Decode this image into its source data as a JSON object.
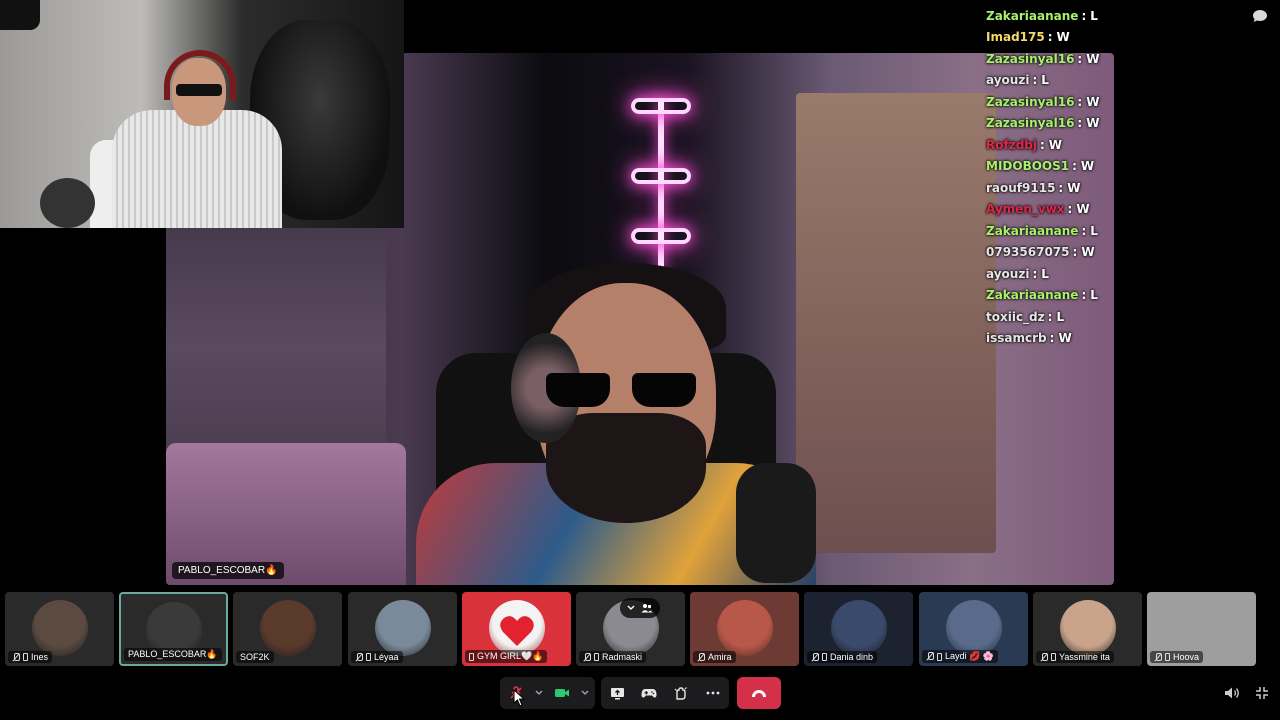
{
  "main_stream": {
    "name_label": "PABLO_ESCOBAR🔥"
  },
  "chat": {
    "messages": [
      {
        "user": "Zakariaanane",
        "text": "L",
        "color": "#a7f26c"
      },
      {
        "user": "Imad175",
        "text": "W",
        "color": "#f6d96a"
      },
      {
        "user": "Zazasinyal16",
        "text": "W",
        "color": "#a7f26c"
      },
      {
        "user": "ayouzi",
        "text": "L",
        "color": "#e6e6e6"
      },
      {
        "user": "Zazasinyal16",
        "text": "W",
        "color": "#a7f26c"
      },
      {
        "user": "Zazasinyal16",
        "text": "W",
        "color": "#a7f26c"
      },
      {
        "user": "Rofzdbj",
        "text": "W",
        "color": "#e0264a"
      },
      {
        "user": "MIDOBOOS1",
        "text": "W",
        "color": "#a7f26c"
      },
      {
        "user": "raouf9115",
        "text": "W",
        "color": "#e6e6e6"
      },
      {
        "user": "Aymen_vwx",
        "text": "W",
        "color": "#e0264a"
      },
      {
        "user": "Zakariaanane",
        "text": "L",
        "color": "#a7f26c"
      },
      {
        "user": "0793567075",
        "text": "W",
        "color": "#e6e6e6"
      },
      {
        "user": "ayouzi",
        "text": "L",
        "color": "#e6e6e6"
      },
      {
        "user": "Zakariaanane",
        "text": "L",
        "color": "#a7f26c"
      },
      {
        "user": "toxiic_dz",
        "text": "L",
        "color": "#e6e6e6"
      },
      {
        "user": "issamcrb",
        "text": "W",
        "color": "#e6e6e6"
      }
    ],
    "separator": ":",
    "icon": "chat-bubble-icon"
  },
  "participants": [
    {
      "name": "Ines",
      "avatar_bg": "#5a4a40",
      "mic_off": true,
      "phone": true
    },
    {
      "name": "PABLO_ESCOBAR🔥",
      "avatar_bg": "#3a3a3a",
      "active": true
    },
    {
      "name": "SOF2K",
      "avatar_bg": "#5a3a2a"
    },
    {
      "name": "Léyaa",
      "avatar_bg": "#7a8a9a",
      "mic_off": true,
      "phone": true
    },
    {
      "name": "GYM GIRL🤍🔥",
      "avatar_bg": "#f3f3f3",
      "tile_bg": "#d9323a",
      "phone": true
    },
    {
      "name": "Radmaski",
      "avatar_bg": "#8a8a90",
      "mic_off": true,
      "phone": true
    },
    {
      "name": "Amira",
      "avatar_bg": "#b7584a",
      "tile_bg": "#6e3a34",
      "mic_off": true
    },
    {
      "name": "Dania dinb",
      "avatar_bg": "#3a4a6a",
      "tile_bg": "#1c2230",
      "mic_off": true,
      "phone": true
    },
    {
      "name": "Laydi 💋 🌸",
      "avatar_bg": "#5a6a8a",
      "tile_bg": "#2a3a52",
      "mic_off": true,
      "phone": true
    },
    {
      "name": "Yassmine ita",
      "avatar_bg": "#caa48a",
      "mic_off": true,
      "phone": true
    },
    {
      "name": "Hoova",
      "avatar_bg": "#bdbdbd",
      "tile_bg": "#9e9e9e",
      "mic_off": true,
      "phone": true
    }
  ],
  "thumb_overlay": {
    "icons": [
      "chevron-down-icon",
      "people-icon"
    ]
  },
  "toolbar": {
    "mic_icon": "mic-off-icon",
    "camera_icon": "camera-icon",
    "share_icon": "screen-share-icon",
    "activity_icon": "gamepad-icon",
    "soundboard_icon": "soundboard-icon",
    "more_icon": "more-icon",
    "end_call_icon": "end-call-icon",
    "volume_icon": "volume-icon",
    "minimize_icon": "minimize-icon",
    "colors": {
      "end_call": "#d5304a",
      "camera": "#2dc770",
      "mic_off": "#e0354a"
    }
  }
}
